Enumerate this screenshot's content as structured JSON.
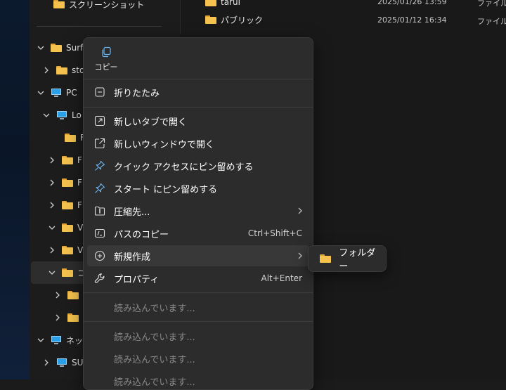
{
  "nav": {
    "top_item": "スクリーンショット",
    "items": [
      {
        "label": "Surf"
      },
      {
        "label": "sto"
      },
      {
        "label": "PC"
      },
      {
        "label": "Lo"
      },
      {
        "label": "F"
      },
      {
        "label": "F"
      },
      {
        "label": "F"
      },
      {
        "label": "F"
      },
      {
        "label": "V"
      },
      {
        "label": "V"
      },
      {
        "label": "コ"
      },
      {
        "label": ""
      },
      {
        "label": ""
      },
      {
        "label": "ネッ"
      },
      {
        "label": "SU"
      }
    ]
  },
  "files": [
    {
      "name": "tarui",
      "date": "2025/01/26 13:59",
      "type": "ファイル"
    },
    {
      "name": "パブリック",
      "date": "2025/01/12 16:34",
      "type": "ファイル"
    }
  ],
  "context_menu": {
    "copy_label": "コピー",
    "collapse": "折りたたみ",
    "open_new_tab": "新しいタブで開く",
    "open_new_window": "新しいウィンドウで開く",
    "pin_quick_access": "クイック アクセスにピン留めする",
    "pin_start": "スタート にピン留めする",
    "compress_to": "圧縮先...",
    "copy_path": "パスのコピー",
    "copy_path_shortcut": "Ctrl+Shift+C",
    "new": "新規作成",
    "properties": "プロパティ",
    "properties_shortcut": "Alt+Enter",
    "loading_1": "読み込んでいます...",
    "loading_2": "読み込んでいます...",
    "loading_3": "読み込んでいます...",
    "loading_4": "読み込んでいます..."
  },
  "submenu": {
    "folder": "フォルダー"
  }
}
